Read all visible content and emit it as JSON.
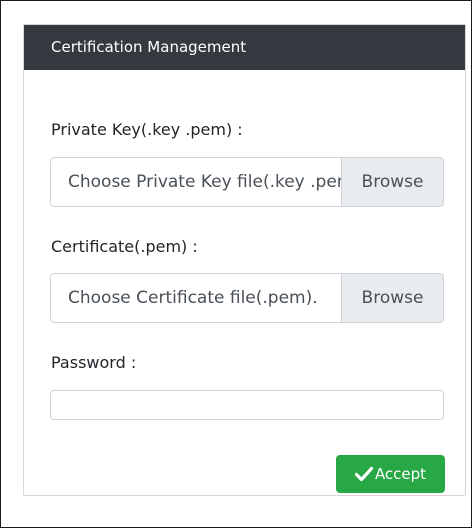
{
  "card": {
    "title": "Certification Management"
  },
  "private_key": {
    "label": "Private Key(.key .pem) :",
    "placeholder": "Choose Private Key file(.key .pem)",
    "browse_label": "Browse"
  },
  "certificate": {
    "label": "Certificate(.pem) :",
    "placeholder": "Choose Certificate file(.pem).",
    "browse_label": "Browse"
  },
  "password": {
    "label": "Password :",
    "value": ""
  },
  "accept_button": {
    "label": "Accept",
    "icon": "checkmark-icon",
    "color": "#28a745"
  },
  "colors": {
    "header_bg": "#343a40",
    "browse_bg": "#e9ecef"
  }
}
